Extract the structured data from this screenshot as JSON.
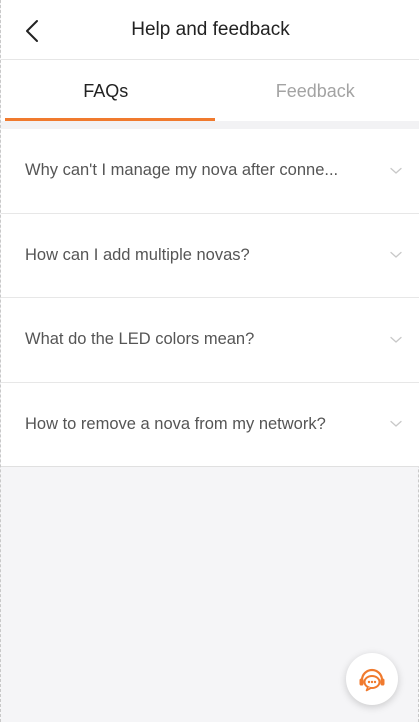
{
  "header": {
    "title": "Help and feedback",
    "back_icon": "chevron-left-icon"
  },
  "tabs": [
    {
      "label": "FAQs",
      "active": true
    },
    {
      "label": "Feedback",
      "active": false
    }
  ],
  "faqs": [
    {
      "question": "Why can't I manage my nova after conne..."
    },
    {
      "question": "How can I add multiple novas?"
    },
    {
      "question": "What do the LED colors mean?"
    },
    {
      "question": "How to remove a nova from my network?"
    }
  ],
  "support_button": {
    "icon": "customer-service-chat-icon"
  },
  "colors": {
    "accent": "#f07a2e",
    "background": "#f5f5f7",
    "text_primary": "#222222",
    "text_secondary": "#555555",
    "tab_inactive": "#a3a3a3"
  }
}
